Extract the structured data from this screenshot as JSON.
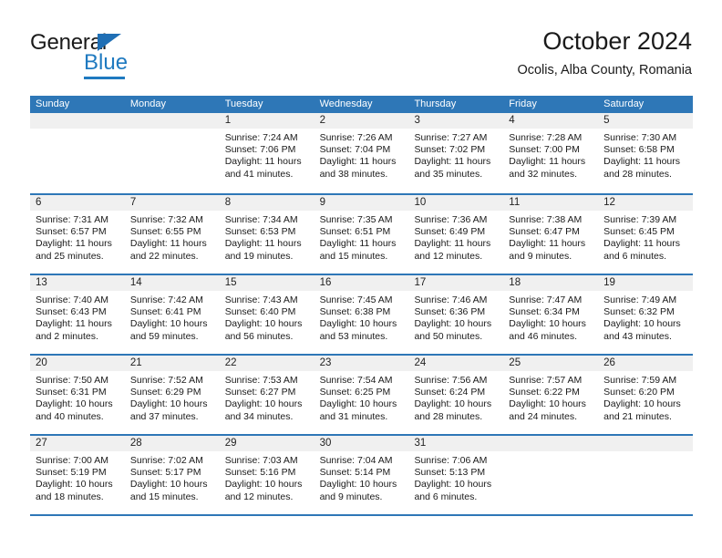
{
  "brand": {
    "name_top": "General",
    "name_bottom": "Blue",
    "accent_color": "#1f7ac0"
  },
  "header": {
    "title": "October 2024",
    "subtitle": "Ocolis, Alba County, Romania"
  },
  "calendar": {
    "header_color": "#2e77b7",
    "day_band_color": "#f0f0f0",
    "weekday_headers": [
      "Sunday",
      "Monday",
      "Tuesday",
      "Wednesday",
      "Thursday",
      "Friday",
      "Saturday"
    ],
    "weeks": [
      [
        {
          "day": "",
          "lines": []
        },
        {
          "day": "",
          "lines": []
        },
        {
          "day": "1",
          "lines": [
            "Sunrise: 7:24 AM",
            "Sunset: 7:06 PM",
            "Daylight: 11 hours",
            "and 41 minutes."
          ]
        },
        {
          "day": "2",
          "lines": [
            "Sunrise: 7:26 AM",
            "Sunset: 7:04 PM",
            "Daylight: 11 hours",
            "and 38 minutes."
          ]
        },
        {
          "day": "3",
          "lines": [
            "Sunrise: 7:27 AM",
            "Sunset: 7:02 PM",
            "Daylight: 11 hours",
            "and 35 minutes."
          ]
        },
        {
          "day": "4",
          "lines": [
            "Sunrise: 7:28 AM",
            "Sunset: 7:00 PM",
            "Daylight: 11 hours",
            "and 32 minutes."
          ]
        },
        {
          "day": "5",
          "lines": [
            "Sunrise: 7:30 AM",
            "Sunset: 6:58 PM",
            "Daylight: 11 hours",
            "and 28 minutes."
          ]
        }
      ],
      [
        {
          "day": "6",
          "lines": [
            "Sunrise: 7:31 AM",
            "Sunset: 6:57 PM",
            "Daylight: 11 hours",
            "and 25 minutes."
          ]
        },
        {
          "day": "7",
          "lines": [
            "Sunrise: 7:32 AM",
            "Sunset: 6:55 PM",
            "Daylight: 11 hours",
            "and 22 minutes."
          ]
        },
        {
          "day": "8",
          "lines": [
            "Sunrise: 7:34 AM",
            "Sunset: 6:53 PM",
            "Daylight: 11 hours",
            "and 19 minutes."
          ]
        },
        {
          "day": "9",
          "lines": [
            "Sunrise: 7:35 AM",
            "Sunset: 6:51 PM",
            "Daylight: 11 hours",
            "and 15 minutes."
          ]
        },
        {
          "day": "10",
          "lines": [
            "Sunrise: 7:36 AM",
            "Sunset: 6:49 PM",
            "Daylight: 11 hours",
            "and 12 minutes."
          ]
        },
        {
          "day": "11",
          "lines": [
            "Sunrise: 7:38 AM",
            "Sunset: 6:47 PM",
            "Daylight: 11 hours",
            "and 9 minutes."
          ]
        },
        {
          "day": "12",
          "lines": [
            "Sunrise: 7:39 AM",
            "Sunset: 6:45 PM",
            "Daylight: 11 hours",
            "and 6 minutes."
          ]
        }
      ],
      [
        {
          "day": "13",
          "lines": [
            "Sunrise: 7:40 AM",
            "Sunset: 6:43 PM",
            "Daylight: 11 hours",
            "and 2 minutes."
          ]
        },
        {
          "day": "14",
          "lines": [
            "Sunrise: 7:42 AM",
            "Sunset: 6:41 PM",
            "Daylight: 10 hours",
            "and 59 minutes."
          ]
        },
        {
          "day": "15",
          "lines": [
            "Sunrise: 7:43 AM",
            "Sunset: 6:40 PM",
            "Daylight: 10 hours",
            "and 56 minutes."
          ]
        },
        {
          "day": "16",
          "lines": [
            "Sunrise: 7:45 AM",
            "Sunset: 6:38 PM",
            "Daylight: 10 hours",
            "and 53 minutes."
          ]
        },
        {
          "day": "17",
          "lines": [
            "Sunrise: 7:46 AM",
            "Sunset: 6:36 PM",
            "Daylight: 10 hours",
            "and 50 minutes."
          ]
        },
        {
          "day": "18",
          "lines": [
            "Sunrise: 7:47 AM",
            "Sunset: 6:34 PM",
            "Daylight: 10 hours",
            "and 46 minutes."
          ]
        },
        {
          "day": "19",
          "lines": [
            "Sunrise: 7:49 AM",
            "Sunset: 6:32 PM",
            "Daylight: 10 hours",
            "and 43 minutes."
          ]
        }
      ],
      [
        {
          "day": "20",
          "lines": [
            "Sunrise: 7:50 AM",
            "Sunset: 6:31 PM",
            "Daylight: 10 hours",
            "and 40 minutes."
          ]
        },
        {
          "day": "21",
          "lines": [
            "Sunrise: 7:52 AM",
            "Sunset: 6:29 PM",
            "Daylight: 10 hours",
            "and 37 minutes."
          ]
        },
        {
          "day": "22",
          "lines": [
            "Sunrise: 7:53 AM",
            "Sunset: 6:27 PM",
            "Daylight: 10 hours",
            "and 34 minutes."
          ]
        },
        {
          "day": "23",
          "lines": [
            "Sunrise: 7:54 AM",
            "Sunset: 6:25 PM",
            "Daylight: 10 hours",
            "and 31 minutes."
          ]
        },
        {
          "day": "24",
          "lines": [
            "Sunrise: 7:56 AM",
            "Sunset: 6:24 PM",
            "Daylight: 10 hours",
            "and 28 minutes."
          ]
        },
        {
          "day": "25",
          "lines": [
            "Sunrise: 7:57 AM",
            "Sunset: 6:22 PM",
            "Daylight: 10 hours",
            "and 24 minutes."
          ]
        },
        {
          "day": "26",
          "lines": [
            "Sunrise: 7:59 AM",
            "Sunset: 6:20 PM",
            "Daylight: 10 hours",
            "and 21 minutes."
          ]
        }
      ],
      [
        {
          "day": "27",
          "lines": [
            "Sunrise: 7:00 AM",
            "Sunset: 5:19 PM",
            "Daylight: 10 hours",
            "and 18 minutes."
          ]
        },
        {
          "day": "28",
          "lines": [
            "Sunrise: 7:02 AM",
            "Sunset: 5:17 PM",
            "Daylight: 10 hours",
            "and 15 minutes."
          ]
        },
        {
          "day": "29",
          "lines": [
            "Sunrise: 7:03 AM",
            "Sunset: 5:16 PM",
            "Daylight: 10 hours",
            "and 12 minutes."
          ]
        },
        {
          "day": "30",
          "lines": [
            "Sunrise: 7:04 AM",
            "Sunset: 5:14 PM",
            "Daylight: 10 hours",
            "and 9 minutes."
          ]
        },
        {
          "day": "31",
          "lines": [
            "Sunrise: 7:06 AM",
            "Sunset: 5:13 PM",
            "Daylight: 10 hours",
            "and 6 minutes."
          ]
        },
        {
          "day": "",
          "lines": []
        },
        {
          "day": "",
          "lines": []
        }
      ]
    ]
  }
}
